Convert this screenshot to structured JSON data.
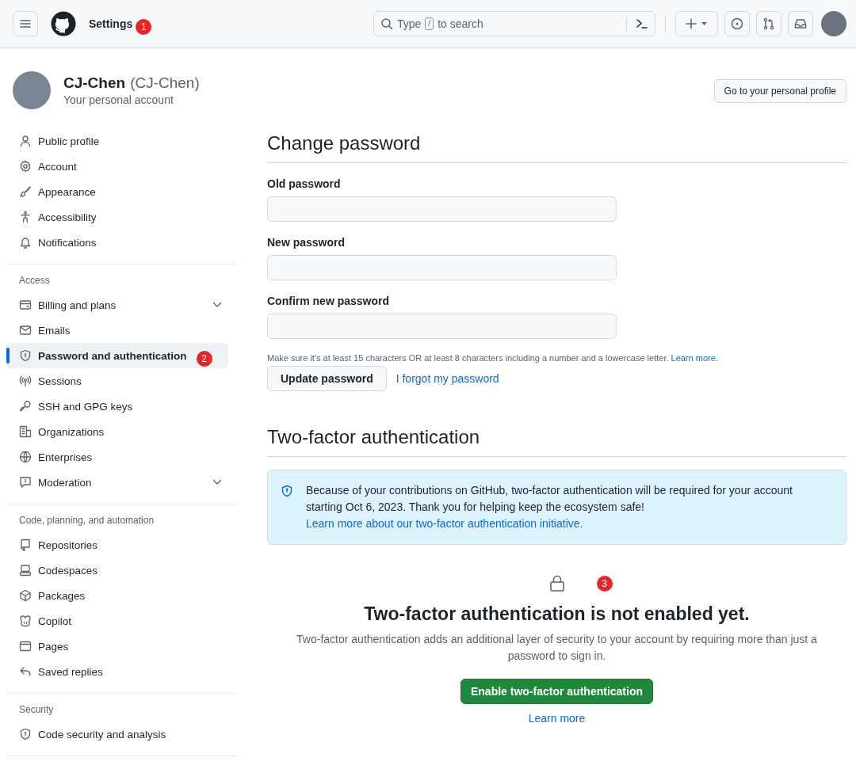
{
  "header": {
    "title": "Settings",
    "marker": "1",
    "search": {
      "placeholder_before": "Type",
      "key": "/",
      "placeholder_after": "to search"
    }
  },
  "profile": {
    "name": "CJ-Chen",
    "login": "(CJ-Chen)",
    "subtitle": "Your personal account",
    "button": "Go to your personal profile"
  },
  "sidebar": {
    "sections": [
      {
        "items": [
          {
            "label": "Public profile",
            "selected": false,
            "expandable": false
          },
          {
            "label": "Account",
            "selected": false,
            "expandable": false
          },
          {
            "label": "Appearance",
            "selected": false,
            "expandable": false
          },
          {
            "label": "Accessibility",
            "selected": false,
            "expandable": false
          },
          {
            "label": "Notifications",
            "selected": false,
            "expandable": false
          }
        ]
      },
      {
        "heading": "Access",
        "items": [
          {
            "label": "Billing and plans",
            "selected": false,
            "expandable": true
          },
          {
            "label": "Emails",
            "selected": false,
            "expandable": false
          },
          {
            "label": "Password and authentication",
            "selected": true,
            "expandable": false,
            "marker": "2"
          },
          {
            "label": "Sessions",
            "selected": false,
            "expandable": false
          },
          {
            "label": "SSH and GPG keys",
            "selected": false,
            "expandable": false
          },
          {
            "label": "Organizations",
            "selected": false,
            "expandable": false
          },
          {
            "label": "Enterprises",
            "selected": false,
            "expandable": false
          },
          {
            "label": "Moderation",
            "selected": false,
            "expandable": true
          }
        ]
      },
      {
        "heading": "Code, planning, and automation",
        "items": [
          {
            "label": "Repositories",
            "selected": false,
            "expandable": false
          },
          {
            "label": "Codespaces",
            "selected": false,
            "expandable": false
          },
          {
            "label": "Packages",
            "selected": false,
            "expandable": false
          },
          {
            "label": "Copilot",
            "selected": false,
            "expandable": false
          },
          {
            "label": "Pages",
            "selected": false,
            "expandable": false
          },
          {
            "label": "Saved replies",
            "selected": false,
            "expandable": false
          }
        ]
      },
      {
        "heading": "Security",
        "items": [
          {
            "label": "Code security and analysis",
            "selected": false,
            "expandable": false
          }
        ]
      }
    ]
  },
  "change_password": {
    "title": "Change password",
    "fields": [
      {
        "label": "Old password"
      },
      {
        "label": "New password"
      },
      {
        "label": "Confirm new password"
      }
    ],
    "hint": "Make sure it's at least 15 characters OR at least 8 characters including a number and a lowercase letter.",
    "hint_link": "Learn more.",
    "button": "Update password",
    "forgot_link": "I forgot my password"
  },
  "two_factor": {
    "title": "Two-factor authentication",
    "notice": "Because of your contributions on GitHub, two-factor authentication will be required for your account starting Oct 6, 2023. Thank you for helping keep the ecosystem safe!",
    "notice_link": "Learn more about our two-factor authentication initiative.",
    "marker": "3",
    "status_title": "Two-factor authentication is not enabled yet.",
    "status_text": "Two-factor authentication adds an additional layer of security to your account by requiring more than just a password to sign in.",
    "enable_button": "Enable two-factor authentication",
    "learn_more": "Learn more"
  }
}
